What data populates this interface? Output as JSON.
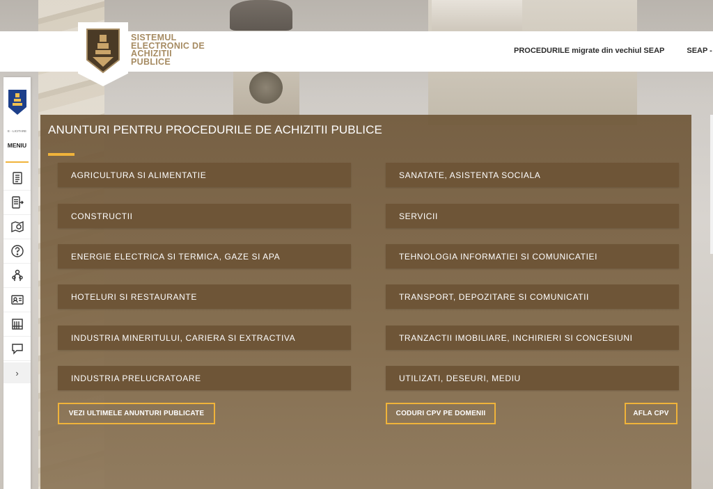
{
  "brand": {
    "lines": [
      "SISTEMUL",
      "ELECTRONIC DE",
      "ACHIZITII",
      "PUBLICE"
    ]
  },
  "nav": {
    "items": [
      "PROCEDURILE migrate din vechiul SEAP",
      "SEAP - DEMO"
    ]
  },
  "sidebar": {
    "caption": "E - LICITARE",
    "menu_label": "MENIU",
    "items": [
      {
        "icon": "document-icon"
      },
      {
        "icon": "list-arrow-icon"
      },
      {
        "icon": "map-pin-icon"
      },
      {
        "icon": "help-icon"
      },
      {
        "icon": "users-icon"
      },
      {
        "icon": "id-card-icon"
      },
      {
        "icon": "building-icon"
      },
      {
        "icon": "chat-icon"
      }
    ],
    "more_glyph": "›"
  },
  "panel": {
    "title": "ANUNTURI PENTRU PROCEDURILE DE ACHIZITII PUBLICE",
    "categories_left": [
      "AGRICULTURA SI ALIMENTATIE",
      "CONSTRUCTII",
      "ENERGIE ELECTRICA SI TERMICA, GAZE SI APA",
      "HOTELURI SI RESTAURANTE",
      "INDUSTRIA MINERITULUI, CARIERA SI EXTRACTIVA",
      "INDUSTRIA PRELUCRATOARE"
    ],
    "categories_right": [
      "SANATATE, ASISTENTA SOCIALA",
      "SERVICII",
      "TEHNOLOGIA INFORMATIEI SI COMUNICATIEI",
      "TRANSPORT, DEPOZITARE SI COMUNICATII",
      "TRANZACTII IMOBILIARE, INCHIRIERI SI CONCESIUNI",
      "UTILIZATI, DESEURI, MEDIU"
    ],
    "buttons": {
      "latest": "VEZI ULTIMELE ANUNTURI PUBLICATE",
      "cpv_domains": "CODURI CPV PE DOMENII",
      "find_cpv": "AFLA CPV"
    }
  },
  "colors": {
    "accent": "#f0b33a",
    "panel_bg": "#76593a",
    "category_bg": "#6e5537",
    "brand_gold": "#a68b62"
  }
}
